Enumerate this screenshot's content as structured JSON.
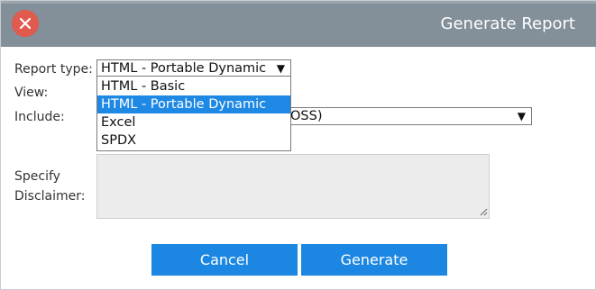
{
  "dialog": {
    "title": "Generate Report",
    "close_icon": "close-x-icon"
  },
  "form": {
    "report_type": {
      "label": "Report type:",
      "selected": "HTML - Portable Dynamic",
      "arrow": "▼",
      "options": [
        "HTML - Basic",
        "HTML - Portable Dynamic",
        "Excel",
        "SPDX"
      ],
      "highlighted_option": "HTML - Portable Dynamic",
      "expanded": true
    },
    "view": {
      "label": "View:"
    },
    "include": {
      "label": "Include:",
      "visible_value": "OSS)",
      "arrow": "▼"
    },
    "disclaimer": {
      "label_line1": "Specify",
      "label_line2": "Disclaimer:",
      "value": ""
    }
  },
  "buttons": {
    "cancel_label": "Cancel",
    "generate_label": "Generate"
  },
  "colors": {
    "titlebar": "#838f99",
    "close": "#e05a4e",
    "accent": "#1c87e3",
    "textarea_bg": "#ececec"
  }
}
